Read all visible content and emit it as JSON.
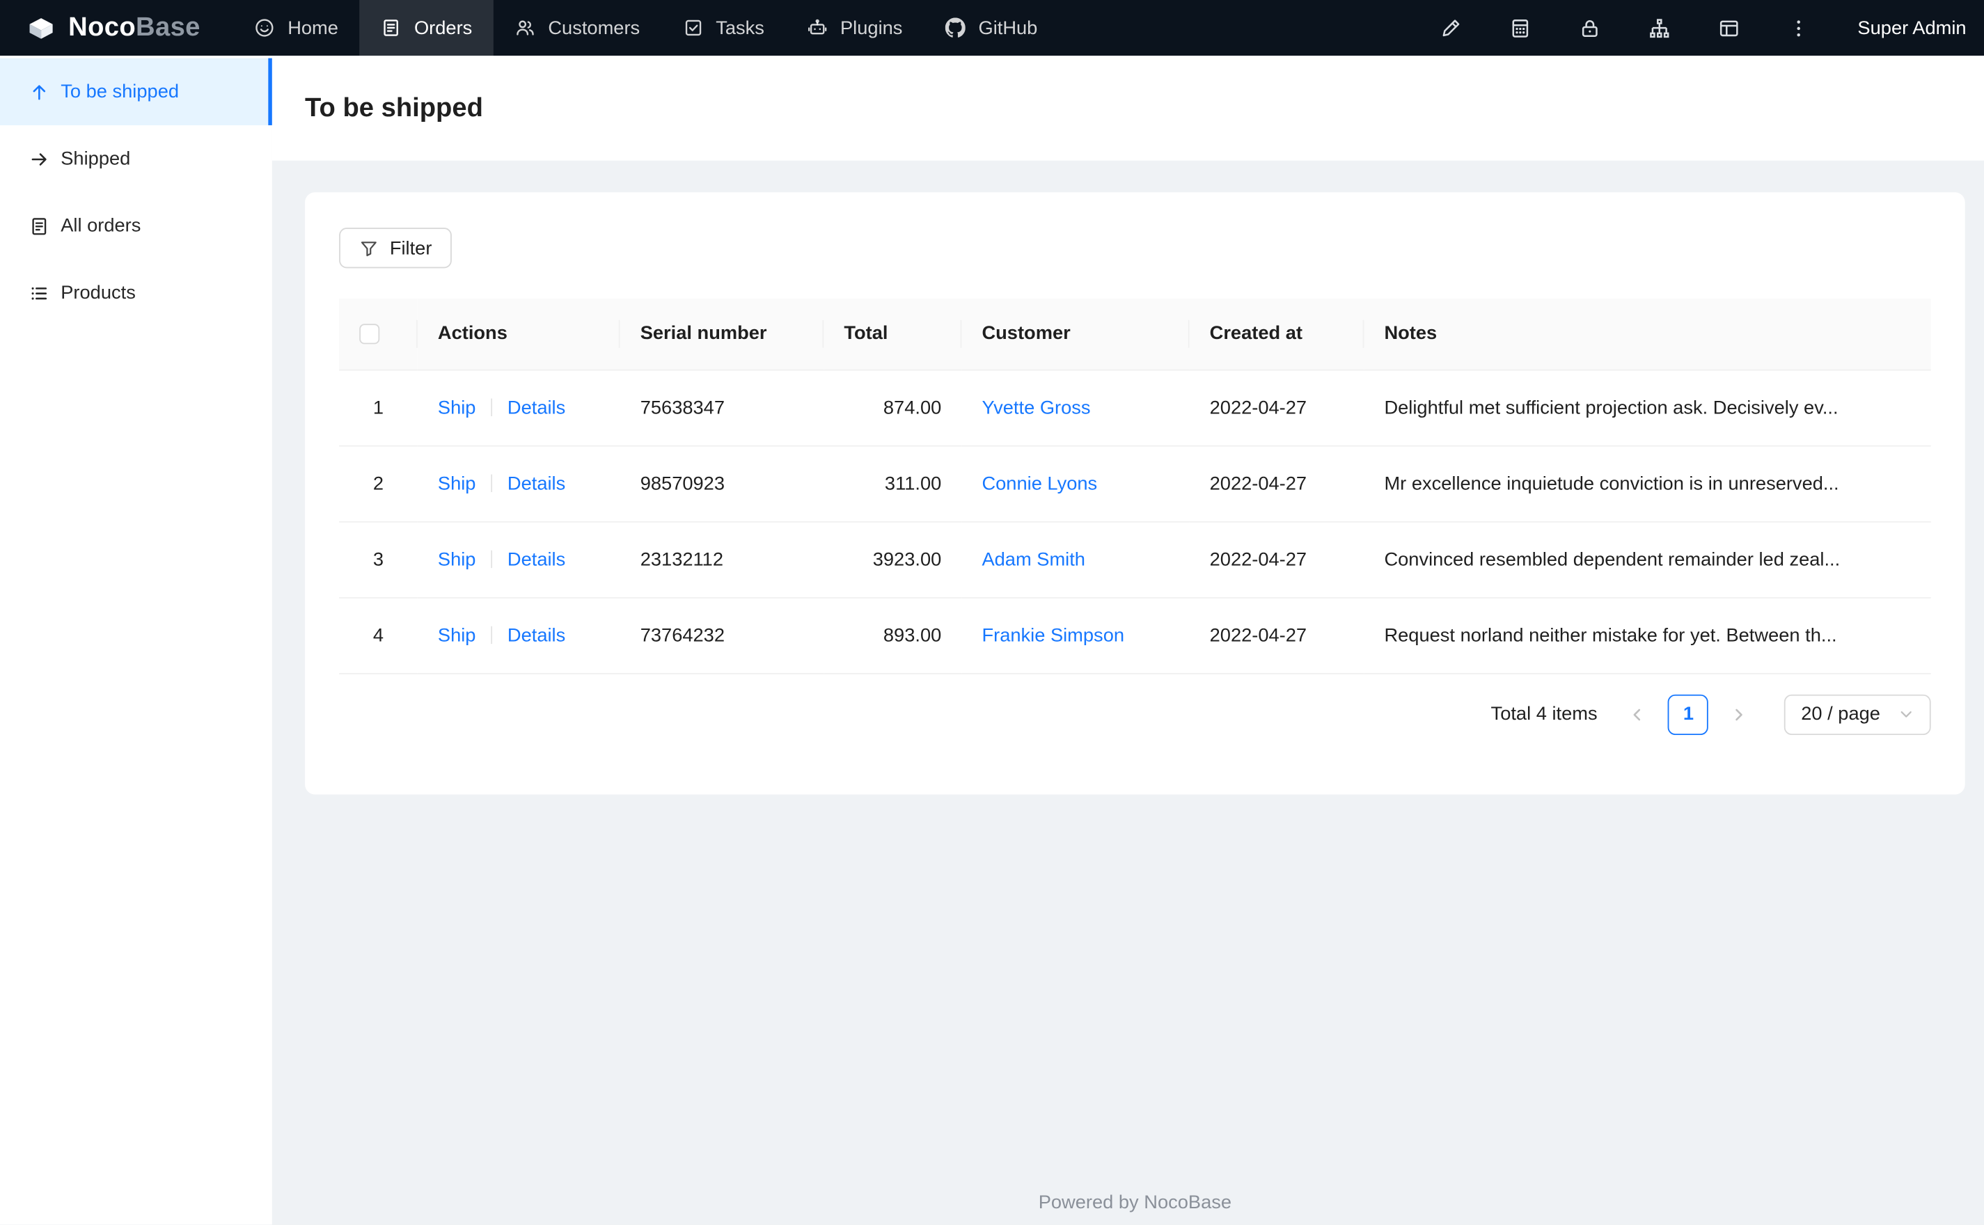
{
  "colors": {
    "accent": "#1677ff",
    "topbar_bg": "#0b131d",
    "content_bg": "#eff2f5",
    "sidebar_active_bg": "#e6f4ff",
    "link": "#1677ff"
  },
  "topbar": {
    "logo_primary": "Noco",
    "logo_secondary": "Base",
    "nav": [
      {
        "label": "Home",
        "active": false
      },
      {
        "label": "Orders",
        "active": true
      },
      {
        "label": "Customers",
        "active": false
      },
      {
        "label": "Tasks",
        "active": false
      },
      {
        "label": "Plugins",
        "active": false
      },
      {
        "label": "GitHub",
        "active": false
      }
    ],
    "user": "Super Admin"
  },
  "icons": {
    "topbar_nav": [
      "home-icon",
      "orders-icon",
      "customers-icon",
      "tasks-icon",
      "plugins-icon",
      "github-icon"
    ],
    "topbar_actions": [
      "highlighter-icon",
      "collections-icon",
      "lock-icon",
      "org-chart-icon",
      "layout-icon",
      "more-vertical-icon"
    ],
    "sidebar": [
      "arrow-up-icon",
      "arrow-right-icon",
      "orders-file-icon",
      "list-icon"
    ],
    "misc": [
      "nocobase-logo-icon",
      "filter-icon",
      "checkbox",
      "chevron-left-icon",
      "chevron-right-icon",
      "chevron-down-icon"
    ]
  },
  "sidebar": {
    "items": [
      {
        "label": "To be shipped",
        "active": true
      },
      {
        "label": "Shipped",
        "active": false
      },
      {
        "label": "All orders",
        "active": false
      },
      {
        "label": "Products",
        "active": false
      }
    ]
  },
  "page": {
    "title": "To be shipped"
  },
  "toolbar": {
    "filter_label": "Filter"
  },
  "table": {
    "columns": {
      "actions": "Actions",
      "serial": "Serial number",
      "total": "Total",
      "customer": "Customer",
      "created_at": "Created at",
      "notes": "Notes"
    },
    "action_labels": {
      "ship": "Ship",
      "details": "Details"
    },
    "rows": [
      {
        "index": "1",
        "serial": "75638347",
        "total": "874.00",
        "customer": "Yvette Gross",
        "created_at": "2022-04-27",
        "notes": "Delightful met sufficient projection ask. Decisively ev..."
      },
      {
        "index": "2",
        "serial": "98570923",
        "total": "311.00",
        "customer": "Connie Lyons",
        "created_at": "2022-04-27",
        "notes": "Mr excellence inquietude conviction is in unreserved..."
      },
      {
        "index": "3",
        "serial": "23132112",
        "total": "3923.00",
        "customer": "Adam Smith",
        "created_at": "2022-04-27",
        "notes": "Convinced resembled dependent remainder led zeal..."
      },
      {
        "index": "4",
        "serial": "73764232",
        "total": "893.00",
        "customer": "Frankie Simpson",
        "created_at": "2022-04-27",
        "notes": "Request norland neither mistake for yet. Between th..."
      }
    ]
  },
  "pagination": {
    "total_text": "Total 4 items",
    "current_page": "1",
    "page_size": "20 / page"
  },
  "footer": {
    "text": "Powered by NocoBase"
  }
}
